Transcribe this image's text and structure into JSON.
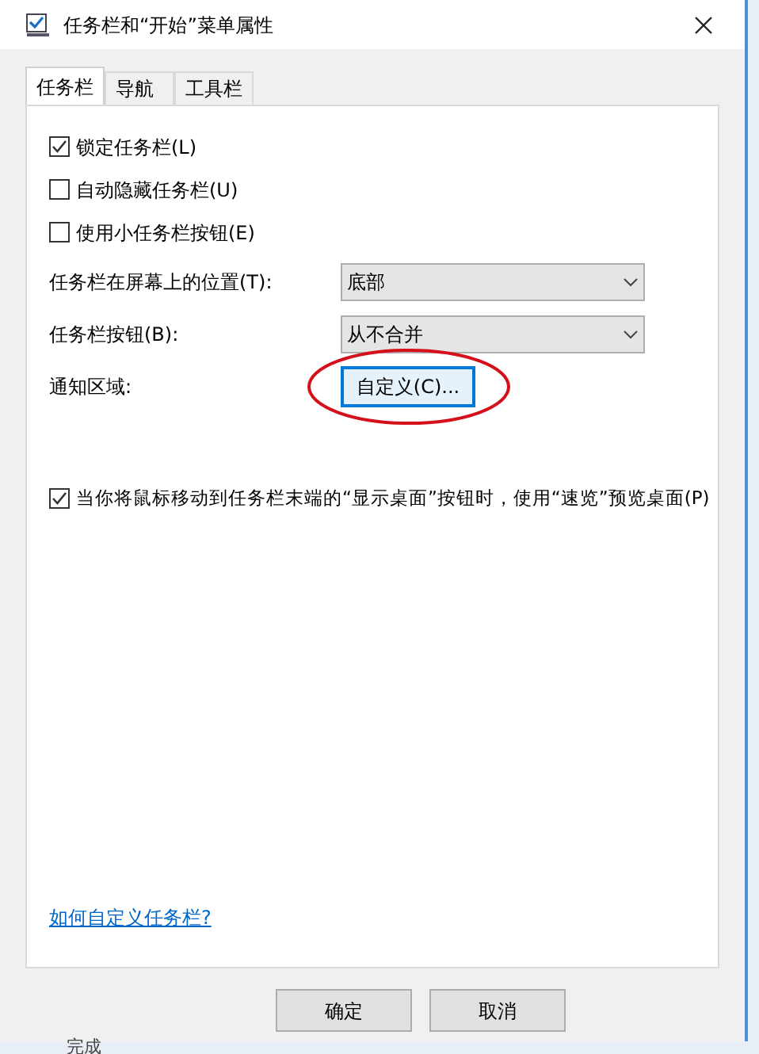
{
  "window": {
    "title": "任务栏和“开始”菜单属性"
  },
  "tabs": [
    {
      "label": "任务栏",
      "selected": true
    },
    {
      "label": "导航",
      "selected": false
    },
    {
      "label": "工具栏",
      "selected": false
    }
  ],
  "options": [
    {
      "label": "锁定任务栏(L)",
      "checked": true
    },
    {
      "label": "自动隐藏任务栏(U)",
      "checked": false
    },
    {
      "label": "使用小任务栏按钮(E)",
      "checked": false
    }
  ],
  "settings": [
    {
      "kind": "dropdown",
      "label": "任务栏在屏幕上的位置(T):",
      "value": "底部"
    },
    {
      "kind": "dropdown",
      "label": "任务栏按钮(B):",
      "value": "从不合并"
    },
    {
      "kind": "button",
      "label": "通知区域:",
      "value": "自定义(C)...",
      "highlighted": true
    }
  ],
  "peek": {
    "label": "当你将鼠标移动到任务栏末端的“显示桌面”按钮时，使用“速览”预览桌面(P)",
    "checked": true
  },
  "help_link": "如何自定义任务栏?",
  "buttons": [
    "确定",
    "取消"
  ],
  "background_status": "完成"
}
